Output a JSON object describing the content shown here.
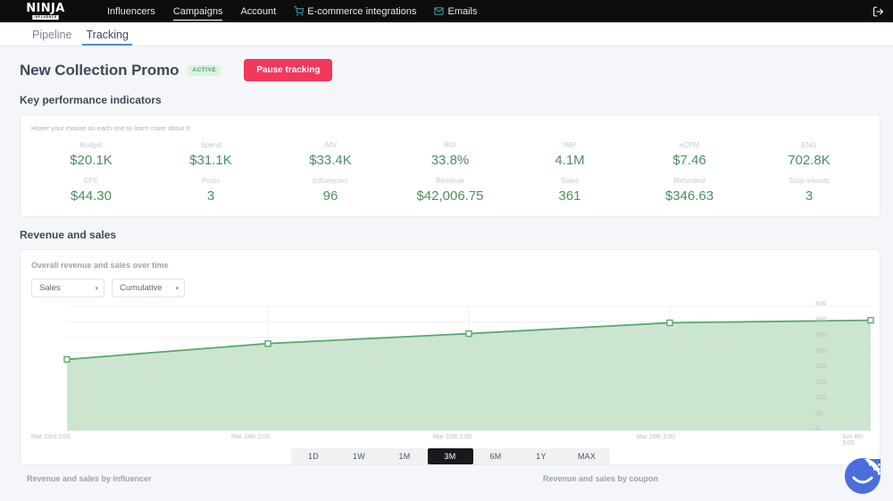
{
  "topnav": {
    "logo_main": "NINJA",
    "logo_sub": "INFLUENCE",
    "links": [
      {
        "label": "Influencers",
        "icon": "",
        "active": false
      },
      {
        "label": "Campaigns",
        "icon": "",
        "active": true
      },
      {
        "label": "Account",
        "icon": "",
        "active": false
      },
      {
        "label": "E-commerce integrations",
        "icon": "cart-icon",
        "active": false
      },
      {
        "label": "Emails",
        "icon": "envelope-icon",
        "active": false
      }
    ],
    "logout_icon": "logout-icon"
  },
  "subnav": {
    "tabs": [
      {
        "label": "Pipeline",
        "active": false
      },
      {
        "label": "Tracking",
        "active": true
      }
    ]
  },
  "header": {
    "title": "New Collection Promo",
    "status_badge": "ACTIVE",
    "pause_button": "Pause tracking"
  },
  "kpi": {
    "section_title": "Key performance indicators",
    "hint": "Hover your mouse on each one to learn more about it",
    "items": [
      {
        "label": "Budget",
        "value": "$20.1K"
      },
      {
        "label": "Spend",
        "value": "$31.1K"
      },
      {
        "label": "IMV",
        "value": "$33.4K"
      },
      {
        "label": "ROI",
        "value": "33.8%"
      },
      {
        "label": "IMP",
        "value": "4.1M"
      },
      {
        "label": "eCPM",
        "value": "$7.46"
      },
      {
        "label": "ENG",
        "value": "702.8K"
      },
      {
        "label": "CPE",
        "value": "$44.30"
      },
      {
        "label": "Posts",
        "value": "3"
      },
      {
        "label": "Influencers",
        "value": "96"
      },
      {
        "label": "Revenue",
        "value": "$42,006.75"
      },
      {
        "label": "Sales",
        "value": "361"
      },
      {
        "label": "Refunded",
        "value": "$346.63"
      },
      {
        "label": "Total refunds",
        "value": "3"
      }
    ]
  },
  "revenue": {
    "section_title": "Revenue and sales",
    "chart_subtitle": "Overall revenue and sales over time",
    "metric_select": "Sales",
    "mode_select": "Cumulative",
    "caret": "▾"
  },
  "chart_data": {
    "type": "area",
    "title": "Overall revenue and sales over time",
    "xlabel": "",
    "ylabel": "",
    "ylim": [
      0,
      400
    ],
    "yticks": [
      400,
      350,
      300,
      250,
      200,
      150,
      100,
      50,
      0
    ],
    "xtick_labels": [
      "Mar 23rd 2:00",
      "Mar 24th 2:00",
      "Mar 25th 2:00",
      "Mar 26th 2:00",
      "Jun 4th 3:00"
    ],
    "grid": true,
    "legend": "none",
    "series": [
      {
        "name": "Sales (cumulative)",
        "color": "#5aa86f",
        "fill": "#c3e0c7",
        "x": [
          "Mar 23rd 2:00",
          "Mar 24th 2:00",
          "Mar 25th 2:00",
          "Mar 26th 2:00",
          "Jun 4th 3:00"
        ],
        "values": [
          229,
          280,
          312,
          347,
          355
        ]
      }
    ]
  },
  "range_selector": {
    "options": [
      "1D",
      "1W",
      "1M",
      "3M",
      "6M",
      "1Y",
      "MAX"
    ],
    "selected": "3M"
  },
  "bottom": {
    "by_influencer": "Revenue and sales by influencer",
    "by_coupon": "Revenue and sales by coupon"
  },
  "chat": {
    "icon": "chat-smiley-icon",
    "color": "#4a6fdc"
  },
  "colors": {
    "accent_green": "#4a8f62",
    "danger": "#f2385a",
    "nav_bg": "#0d0d0d",
    "icon_teal": "#2fb9c4"
  }
}
